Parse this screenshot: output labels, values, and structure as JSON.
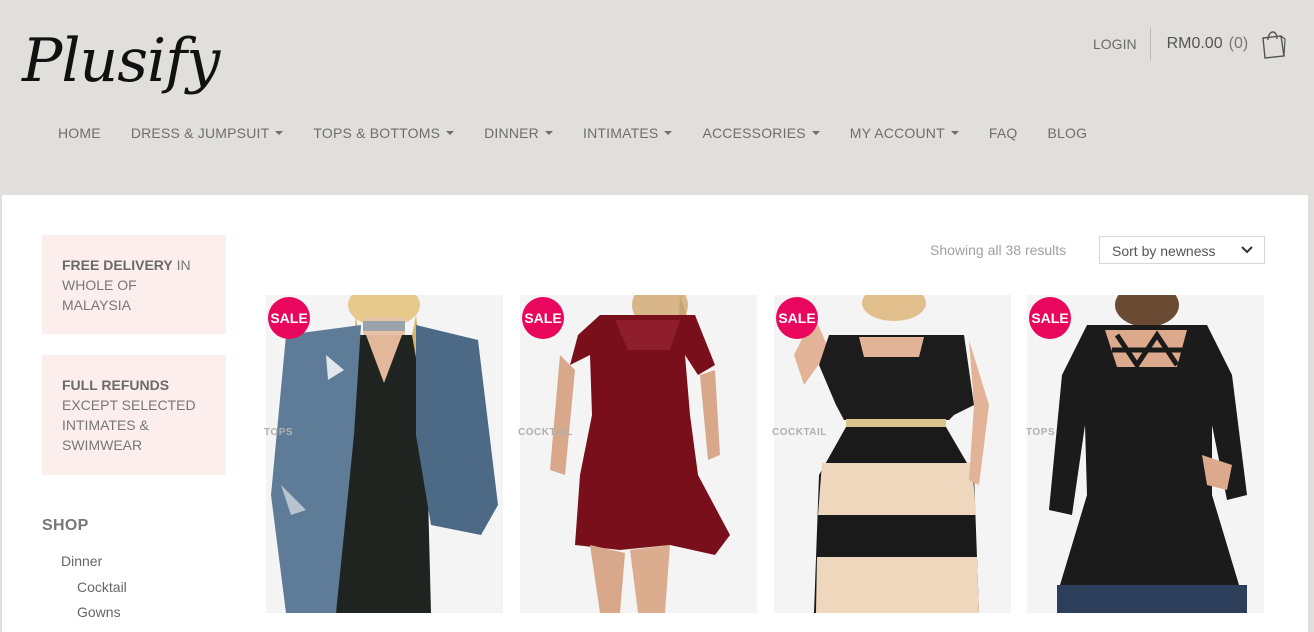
{
  "brand": {
    "logo_text": "Plusify"
  },
  "header": {
    "login_label": "LOGIN",
    "cart_total": "RM0.00",
    "cart_count": "(0)",
    "nav": [
      {
        "label": "HOME",
        "dropdown": false
      },
      {
        "label": "DRESS & JUMPSUIT",
        "dropdown": true
      },
      {
        "label": "TOPS & BOTTOMS",
        "dropdown": true
      },
      {
        "label": "DINNER",
        "dropdown": true
      },
      {
        "label": "INTIMATES",
        "dropdown": true
      },
      {
        "label": "ACCESSORIES",
        "dropdown": true
      },
      {
        "label": "MY ACCOUNT",
        "dropdown": true
      },
      {
        "label": "FAQ",
        "dropdown": false
      },
      {
        "label": "BLOG",
        "dropdown": false
      }
    ]
  },
  "sidebar": {
    "promo1": {
      "bold": "FREE DELIVERY",
      "rest": " IN WHOLE OF MALAYSIA"
    },
    "promo2": {
      "bold": "FULL REFUNDS",
      "rest": " EXCEPT SELECTED INTIMATES & SWIMWEAR"
    },
    "shop_title": "SHOP",
    "categories": [
      "Dinner",
      "Cocktail",
      "Gowns"
    ]
  },
  "listing": {
    "results_text": "Showing all 38 results",
    "sort_value": "Sort by newness",
    "products": [
      {
        "badge": "SALE",
        "category": "TOPS"
      },
      {
        "badge": "SALE",
        "category": "COCKTAIL"
      },
      {
        "badge": "SALE",
        "category": "COCKTAIL"
      },
      {
        "badge": "SALE",
        "category": "TOPS"
      }
    ]
  },
  "colors": {
    "header_bg": "#e0dfdb",
    "promo_bg": "#fdeeee",
    "sale_badge": "#e8075d"
  }
}
